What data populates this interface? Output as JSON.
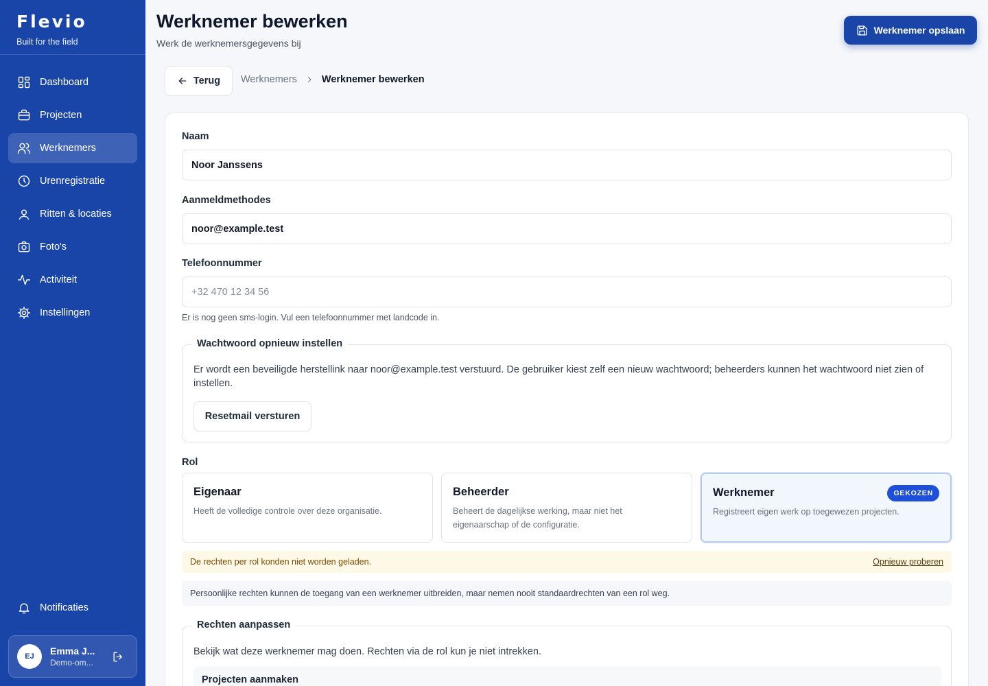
{
  "brand": {
    "name": "Flevio",
    "tagline": "Built for the field"
  },
  "nav": {
    "items": [
      {
        "label": "Dashboard",
        "icon": "dashboard-icon"
      },
      {
        "label": "Projecten",
        "icon": "briefcase-icon"
      },
      {
        "label": "Werknemers",
        "icon": "users-icon",
        "active": true
      },
      {
        "label": "Urenregistratie",
        "icon": "clock-icon"
      },
      {
        "label": "Ritten & locaties",
        "icon": "map-pin-icon"
      },
      {
        "label": "Foto's",
        "icon": "camera-icon"
      },
      {
        "label": "Activiteit",
        "icon": "activity-icon"
      },
      {
        "label": "Instellingen",
        "icon": "gear-icon"
      }
    ],
    "notifications": "Notificaties"
  },
  "user": {
    "initials": "EJ",
    "name": "Emma J...",
    "org": "Demo-om..."
  },
  "header": {
    "title": "Werknemer bewerken",
    "subtitle": "Werk de werknemersgegevens bij",
    "save_label": "Werknemer opslaan"
  },
  "breadcrumb": {
    "back_label": "Terug",
    "parent": "Werknemers",
    "current": "Werknemer bewerken"
  },
  "form": {
    "name_label": "Naam",
    "name_value": "Noor Janssens",
    "login_label": "Aanmeldmethodes",
    "login_value": "noor@example.test",
    "phone_label": "Telefoonnummer",
    "phone_placeholder": "+32 470 12 34 56",
    "phone_hint": "Er is nog geen sms-login. Vul een telefoonnummer met landcode in."
  },
  "reset": {
    "legend": "Wachtwoord opnieuw instellen",
    "text": "Er wordt een beveiligde herstellink naar noor@example.test verstuurd. De gebruiker kiest zelf een nieuw wachtwoord; beheerders kunnen het wachtwoord niet zien of instellen.",
    "button": "Resetmail versturen"
  },
  "role": {
    "label": "Rol",
    "options": [
      {
        "title": "Eigenaar",
        "description": "Heeft de volledige controle over deze organisatie."
      },
      {
        "title": "Beheerder",
        "description": "Beheert de dagelijkse werking, maar niet het eigenaarschap of de configuratie."
      },
      {
        "title": "Werknemer",
        "description": "Registreert eigen werk op toegewezen projecten.",
        "selected": true,
        "badge": "GEKOZEN"
      }
    ]
  },
  "alerts": {
    "warning": "De rechten per rol konden niet worden geladen.",
    "retry": "Opnieuw proberen",
    "info": "Persoonlijke rechten kunnen de toegang van een werknemer uitbreiden, maar nemen nooit standaardrechten van een rol weg."
  },
  "permissions": {
    "legend": "Rechten aanpassen",
    "text": "Bekijk wat deze werknemer mag doen. Rechten via de rol kun je niet intrekken.",
    "first_item": "Projecten aanmaken"
  },
  "colors": {
    "sidebar": "#1a45a8",
    "accent": "#1d4fd8",
    "warning_bg": "#fef9e7"
  }
}
